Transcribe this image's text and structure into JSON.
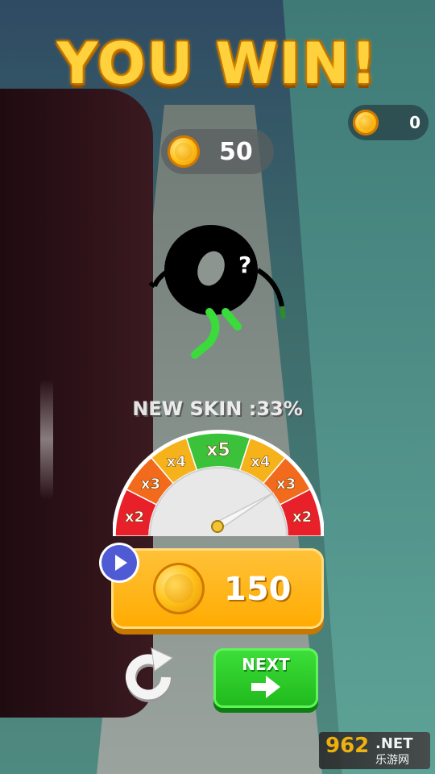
{
  "header": {
    "title": "YOU WIN!"
  },
  "wallet": {
    "total_coins": "0"
  },
  "reward": {
    "earned_coins": "50"
  },
  "progress": {
    "label": "NEW SKIN :33%",
    "percent": 33
  },
  "multiplier_meter": {
    "segments": [
      "x2",
      "x3",
      "x4",
      "x5",
      "x4",
      "x3",
      "x2"
    ],
    "colors": [
      "#e8202a",
      "#f26a1b",
      "#f5b21a",
      "#3cc23a",
      "#f5b21a",
      "#f26a1b",
      "#e8202a"
    ]
  },
  "bonus_button": {
    "value": "150"
  },
  "next_button": {
    "label": "NEXT"
  },
  "character": {
    "mystery_mark": "?"
  },
  "watermark": {
    "brand": "962",
    "suffix": ".NET",
    "sub": "乐游网"
  },
  "colors": {
    "accent": "#ffab00",
    "next": "#1fb81b",
    "ad_badge": "#4f5bd5"
  },
  "icons": [
    "coin-icon",
    "play-icon",
    "replay-icon",
    "arrow-right-icon"
  ]
}
